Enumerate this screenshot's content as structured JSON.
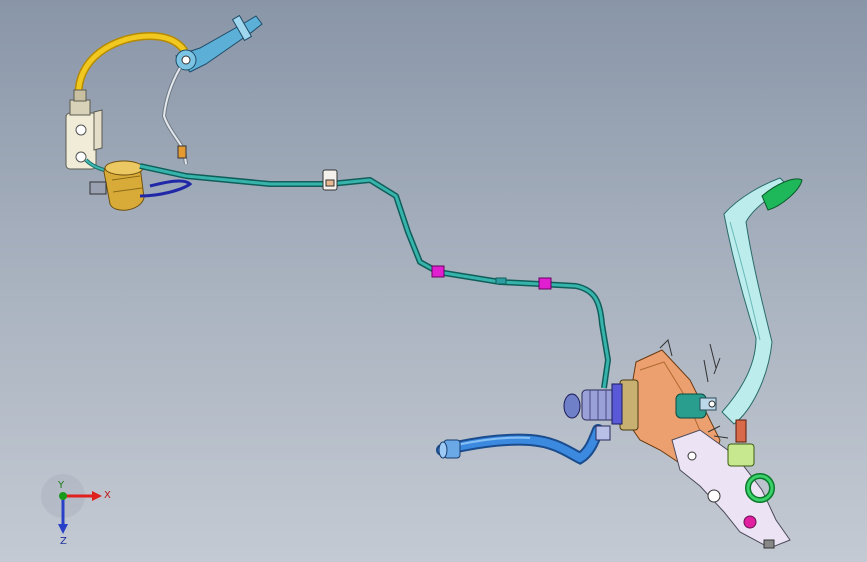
{
  "triad": {
    "x_label": "X",
    "y_label": "Y",
    "z_label": "Z",
    "x_color": "#e0201c",
    "y_color": "#1a9a1a",
    "z_color": "#2840c8"
  },
  "colors": {
    "background_top": "#8996a8",
    "background_bottom": "#c4cad3",
    "tube_teal": "#1e8f8a",
    "hose_blue": "#2e78d0",
    "hose_yellow": "#e6b800",
    "clip_magenta": "#e020d0",
    "pedal_arm": "#b8ecec",
    "pedal_pad": "#22b55a",
    "bracket_orange": "#e8a070",
    "reservoir_yellow": "#e0b848"
  }
}
